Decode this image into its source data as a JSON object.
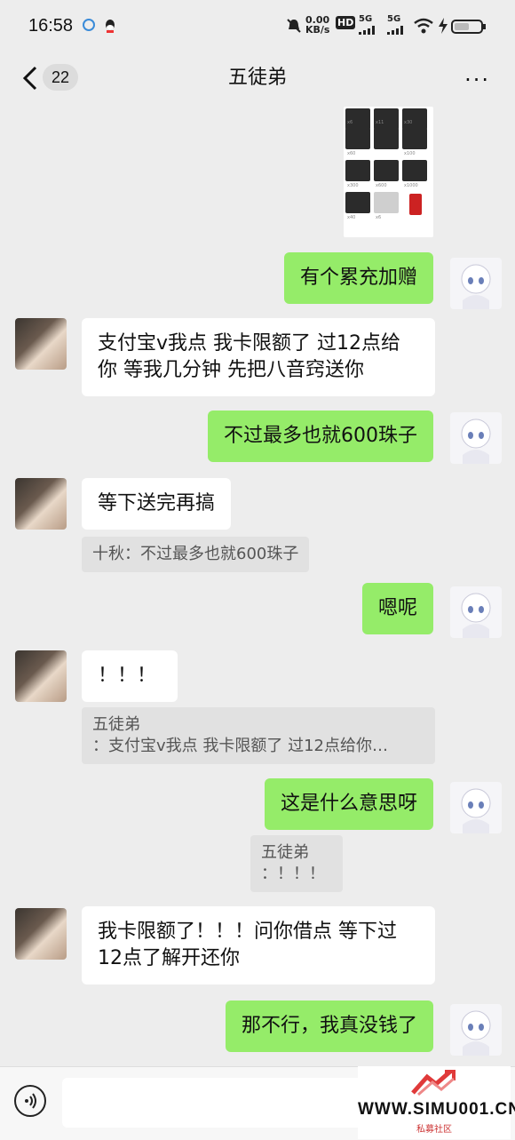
{
  "status_bar": {
    "time": "16:58",
    "net_speed": "0.00\nKB/s",
    "hd": "HD",
    "sim1": "5G",
    "sim2": "5G"
  },
  "header": {
    "back_count": "22",
    "title": "五徒弟",
    "more": "···"
  },
  "messages": [
    {
      "from": "me",
      "text": "有个累充加赠"
    },
    {
      "from": "other",
      "text": "支付宝v我点 我卡限额了  过12点给你  等我几分钟 先把八音窍送你"
    },
    {
      "from": "me",
      "text": "不过最多也就600珠子"
    },
    {
      "from": "other",
      "text": "等下送完再搞",
      "quote": "十秋：不过最多也就600珠子"
    },
    {
      "from": "me",
      "text": "嗯呢"
    },
    {
      "from": "other",
      "text": "！！！",
      "quote_line1": "五徒弟",
      "quote_line2": "：支付宝v我点 我卡限额了  过12点给你…"
    },
    {
      "from": "me",
      "text": "这是什么意思呀",
      "quote_line1": "五徒弟",
      "quote_line2": "：！！！"
    },
    {
      "from": "other",
      "text": "我卡限额了！！！问你借点 等下过12点了解开还你"
    },
    {
      "from": "me",
      "text": "那不行，我真没钱了"
    }
  ],
  "image_labels": [
    "x6",
    "x11",
    "x30",
    "x60",
    "x100",
    "x300",
    "x600",
    "x1000",
    "x40",
    "x6"
  ],
  "watermark": {
    "site": "WWW.SIMU001.CN",
    "sub": "私募社区"
  },
  "colors": {
    "me_bubble": "#95ec69",
    "other_bubble": "#ffffff",
    "background": "#ededed"
  }
}
